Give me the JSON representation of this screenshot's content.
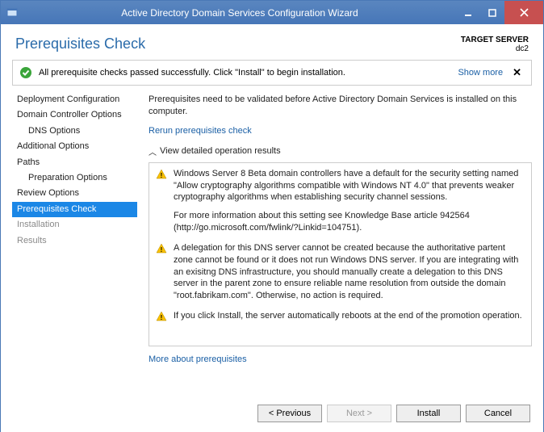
{
  "window": {
    "title": "Active Directory Domain Services Configuration Wizard"
  },
  "header": {
    "page_title": "Prerequisites Check",
    "target_label": "TARGET SERVER",
    "target_value": "dc2"
  },
  "status": {
    "message": "All prerequisite checks passed successfully. Click \"Install\" to begin installation.",
    "show_more": "Show more",
    "close": "✕"
  },
  "sidebar": {
    "items": [
      {
        "label": "Deployment Configuration",
        "indent": false
      },
      {
        "label": "Domain Controller Options",
        "indent": false
      },
      {
        "label": "DNS Options",
        "indent": true
      },
      {
        "label": "Additional Options",
        "indent": false
      },
      {
        "label": "Paths",
        "indent": false
      },
      {
        "label": "Preparation Options",
        "indent": true
      },
      {
        "label": "Review Options",
        "indent": false
      },
      {
        "label": "Prerequisites Check",
        "indent": false,
        "selected": true
      },
      {
        "label": "Installation",
        "indent": false,
        "disabled": true
      },
      {
        "label": "Results",
        "indent": false,
        "disabled": true
      }
    ]
  },
  "main": {
    "intro": "Prerequisites need to be validated before Active Directory Domain Services is installed on this computer.",
    "rerun": "Rerun prerequisites check",
    "details_header": "View detailed operation results",
    "results": [
      {
        "paragraphs": [
          "Windows Server 8 Beta domain controllers have a default for the security setting named \"Allow cryptography algorithms compatible with Windows NT 4.0\" that prevents weaker cryptography algorithms when establishing security channel sessions.",
          "For more information about this setting see Knowledge Base article 942564 (http://go.microsoft.com/fwlink/?Linkid=104751)."
        ]
      },
      {
        "paragraphs": [
          "A delegation for this DNS server cannot be created because the authoritative partent zone cannot be found or it does not run Windows DNS server. If you are integrating with an exisitng DNS infrastructure, you should manually create a delegation to this DNS server in the parent zone to ensure reliable name resolution from outside the domain \"root.fabrikam.com\". Otherwise, no action is required."
        ]
      },
      {
        "paragraphs": [
          "If you click Install, the server automatically reboots at the end of the promotion operation."
        ]
      }
    ],
    "more_link": "More about prerequisites"
  },
  "buttons": {
    "previous": "< Previous",
    "next": "Next >",
    "install": "Install",
    "cancel": "Cancel"
  }
}
